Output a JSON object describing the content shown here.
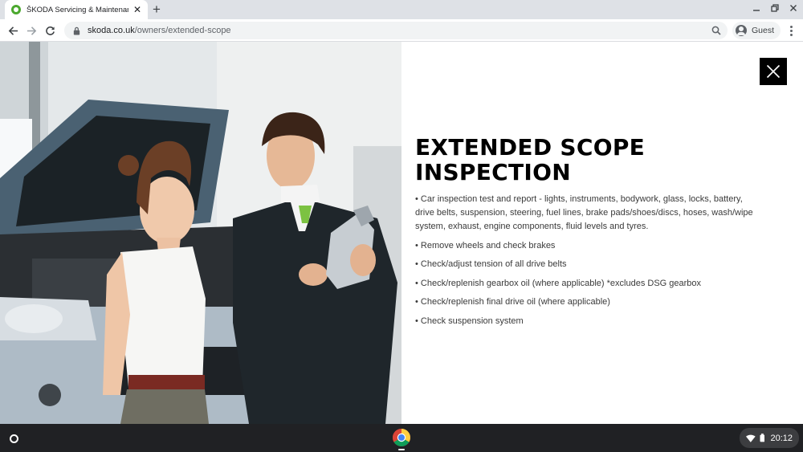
{
  "browser": {
    "tab_title": "ŠKODA Servicing & Maintenance",
    "url_domain": "skoda.co.uk",
    "url_path": "/owners/extended-scope",
    "profile_label": "Guest"
  },
  "colors": {
    "brand_green": "#4ba82e",
    "tie_green": "#7cc242",
    "close_button": "#000000",
    "shelf": "#202124"
  },
  "icons": [
    "skoda-favicon",
    "tab-close-icon",
    "new-tab-icon",
    "minimize-icon",
    "restore-icon",
    "window-close-icon",
    "back-arrow-icon",
    "forward-arrow-icon",
    "reload-icon",
    "lock-icon",
    "search-icon",
    "guest-avatar-icon",
    "menu-kebab-icon",
    "close-icon",
    "launcher-icon",
    "chrome-app-icon",
    "wifi-icon",
    "battery-icon"
  ],
  "main": {
    "heading_line1": "EXTENDED SCOPE",
    "heading_line2": "INSPECTION",
    "bullets": [
      "• Car inspection test and report - lights, instruments, bodywork, glass, locks, battery, drive belts, suspension, steering, fuel lines, brake pads/shoes/discs, hoses, wash/wipe system, exhaust, engine components, fluid levels and tyres.",
      "• Remove wheels and check brakes",
      "• Check/adjust tension of all drive belts",
      "• Check/replenish gearbox oil (where applicable) *excludes DSG gearbox",
      "• Check/replenish final drive oil (where applicable)",
      "• Check suspension system"
    ]
  },
  "shelf": {
    "time": "20:12"
  }
}
